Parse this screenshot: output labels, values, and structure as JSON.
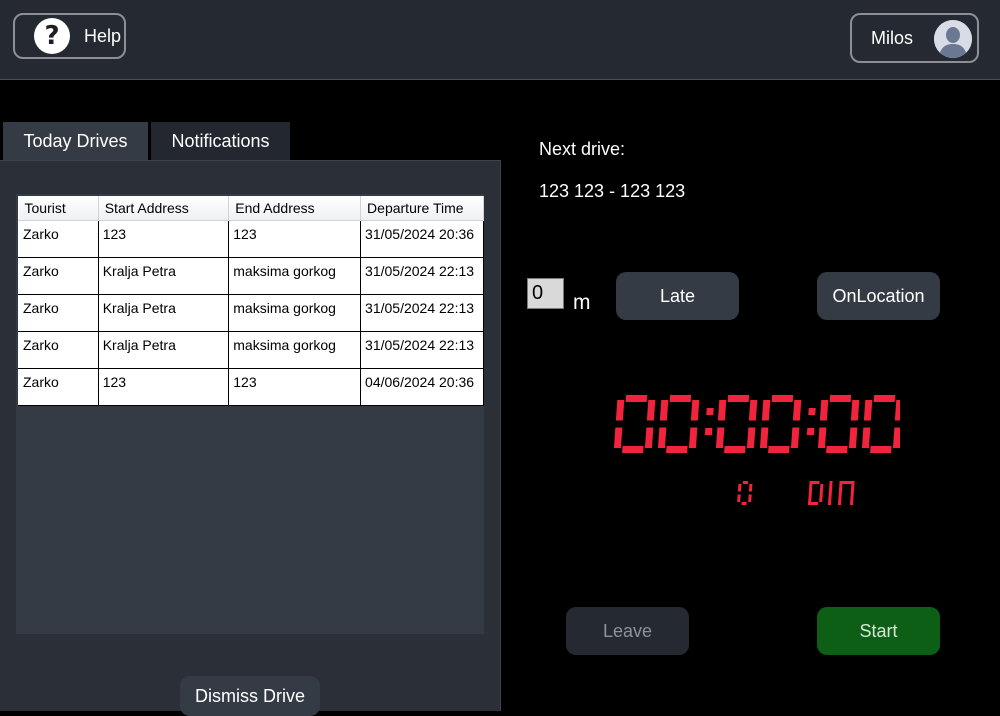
{
  "header": {
    "help_label": "Help",
    "help_icon": "question-circle-icon",
    "user_name": "Milos",
    "avatar_icon": "user-avatar-icon"
  },
  "tabs": [
    {
      "label": "Today Drives",
      "active": true
    },
    {
      "label": "Notifications",
      "active": false
    }
  ],
  "drives_table": {
    "columns": [
      "Tourist",
      "Start Address",
      "End Address",
      "Departure Time"
    ],
    "rows": [
      [
        "Zarko",
        "123",
        "123",
        "31/05/2024 20:36"
      ],
      [
        "Zarko",
        "Kralja Petra",
        "maksima gorkog",
        "31/05/2024 22:13"
      ],
      [
        "Zarko",
        "Kralja Petra",
        "maksima gorkog",
        "31/05/2024 22:13"
      ],
      [
        "Zarko",
        "Kralja Petra",
        "maksima gorkog",
        "31/05/2024 22:13"
      ],
      [
        "Zarko",
        "123",
        "123",
        "04/06/2024 20:36"
      ]
    ]
  },
  "dismiss_label": "Dismiss Drive",
  "next_drive": {
    "label": "Next drive:",
    "value": "123 123 - 123 123"
  },
  "delay": {
    "value": "0",
    "unit": "m",
    "late_label": "Late",
    "on_location_label": "OnLocation"
  },
  "timer": {
    "time": "00:00:00",
    "fare": "0",
    "currency": "DIN",
    "color": "#f0253d"
  },
  "buttons": {
    "leave_label": "Leave",
    "start_label": "Start"
  },
  "colors": {
    "background": "#000000",
    "topbar": "#252932",
    "panel": "#2b3038",
    "button": "#353b45",
    "start": "#0c5f14"
  }
}
